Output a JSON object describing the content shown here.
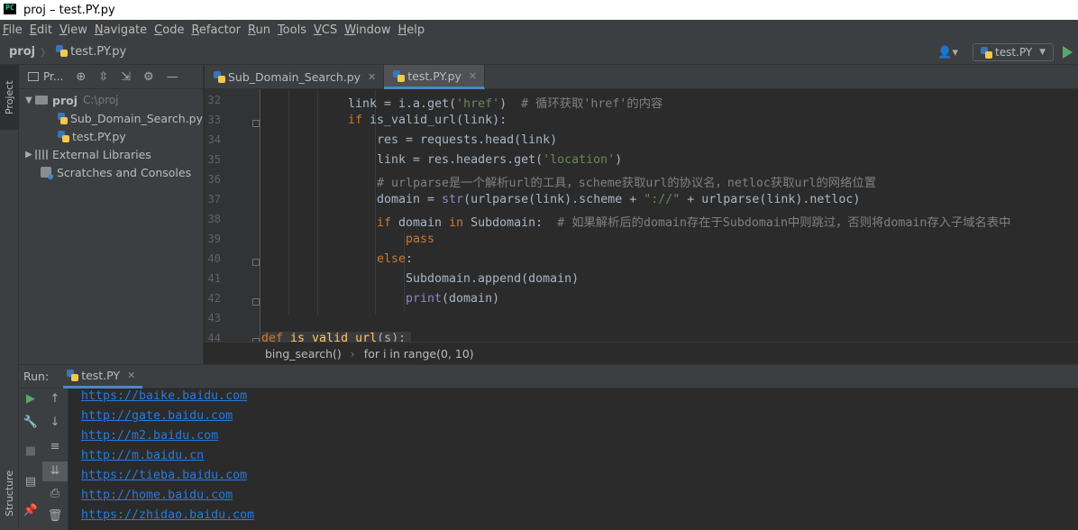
{
  "window": {
    "title": "proj – test.PY.py"
  },
  "menu": [
    "File",
    "Edit",
    "View",
    "Navigate",
    "Code",
    "Refactor",
    "Run",
    "Tools",
    "VCS",
    "Window",
    "Help"
  ],
  "navbar": {
    "project": "proj",
    "file": "test.PY.py"
  },
  "run_config": {
    "label": "test.PY"
  },
  "side_tabs": {
    "project": "Project",
    "structure": "Structure"
  },
  "project_panel": {
    "title": "Pr...",
    "tree": [
      {
        "arrow": "▼",
        "name": "proj",
        "path": "C:\\proj"
      },
      {
        "name": "Sub_Domain_Search.py"
      },
      {
        "name": "test.PY.py"
      },
      {
        "arrow": "▶",
        "name": "External Libraries"
      },
      {
        "name": "Scratches and Consoles"
      }
    ]
  },
  "editor_tabs": [
    {
      "label": "Sub_Domain_Search.py",
      "active": false
    },
    {
      "label": "test.PY.py",
      "active": true
    }
  ],
  "editor": {
    "line_numbers": [
      "32",
      "33",
      "34",
      "35",
      "36",
      "37",
      "38",
      "39",
      "40",
      "41",
      "42",
      "43",
      "44"
    ]
  },
  "breadcrumb": [
    "bing_search()",
    "for i in range(0, 10)"
  ],
  "run_panel": {
    "label": "Run:",
    "tab": "test.PY",
    "output": [
      "https://baike.baidu.com",
      "http://gate.baidu.com",
      "http://m2.baidu.com",
      "http://m.baidu.cn",
      "https://tieba.baidu.com",
      "http://home.baidu.com",
      "https://zhidao.baidu.com"
    ]
  },
  "colors": {
    "keyword": "#cc7832",
    "string": "#6a8759",
    "comment": "#808080",
    "builtin": "#8888c6",
    "link": "#287bde",
    "accent": "#4a88c7"
  }
}
